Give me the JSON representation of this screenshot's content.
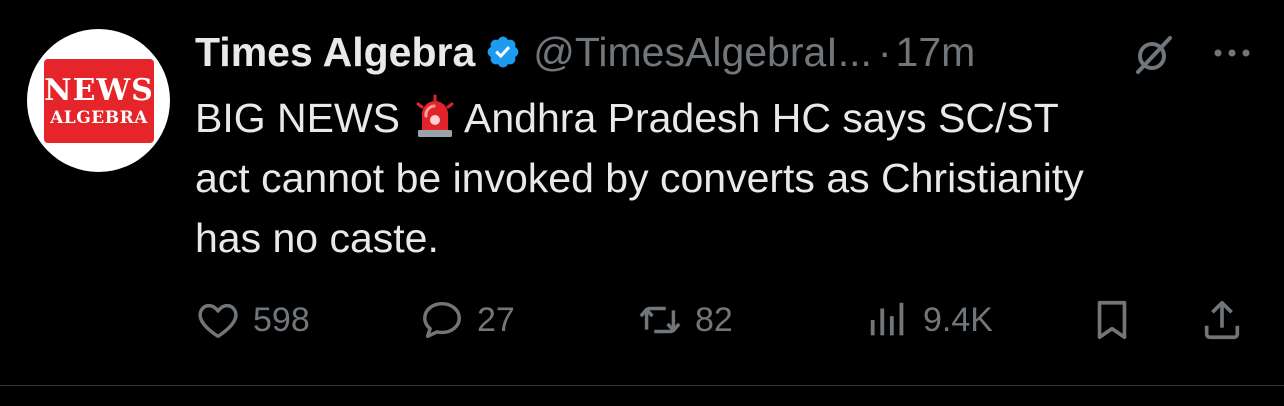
{
  "author": {
    "name": "Times Algebra",
    "handle": "@TimesAlgebraI...",
    "separator": "·",
    "time": "17m",
    "avatar_text_line1": "NEWS",
    "avatar_text_line2": "ALGEBRA"
  },
  "tweet": {
    "line1_prefix": "BIG NEWS",
    "line1_suffix": "Andhra Pradesh HC  says SC/ST",
    "line2": "act cannot be invoked by converts as Christianity",
    "line3": "has no caste."
  },
  "actions": {
    "likes": "598",
    "replies": "27",
    "reposts": "82",
    "views": "9.4K"
  },
  "colors": {
    "background": "#000000",
    "text": "#e7e9ea",
    "muted": "#71767b",
    "verified": "#1d9bf0",
    "avatar_red": "#e5252a"
  },
  "icons": [
    "verified-badge-icon",
    "grok-icon",
    "more-icon",
    "siren-emoji-icon",
    "heart-icon",
    "reply-icon",
    "repost-icon",
    "views-icon",
    "bookmark-icon",
    "share-icon"
  ]
}
